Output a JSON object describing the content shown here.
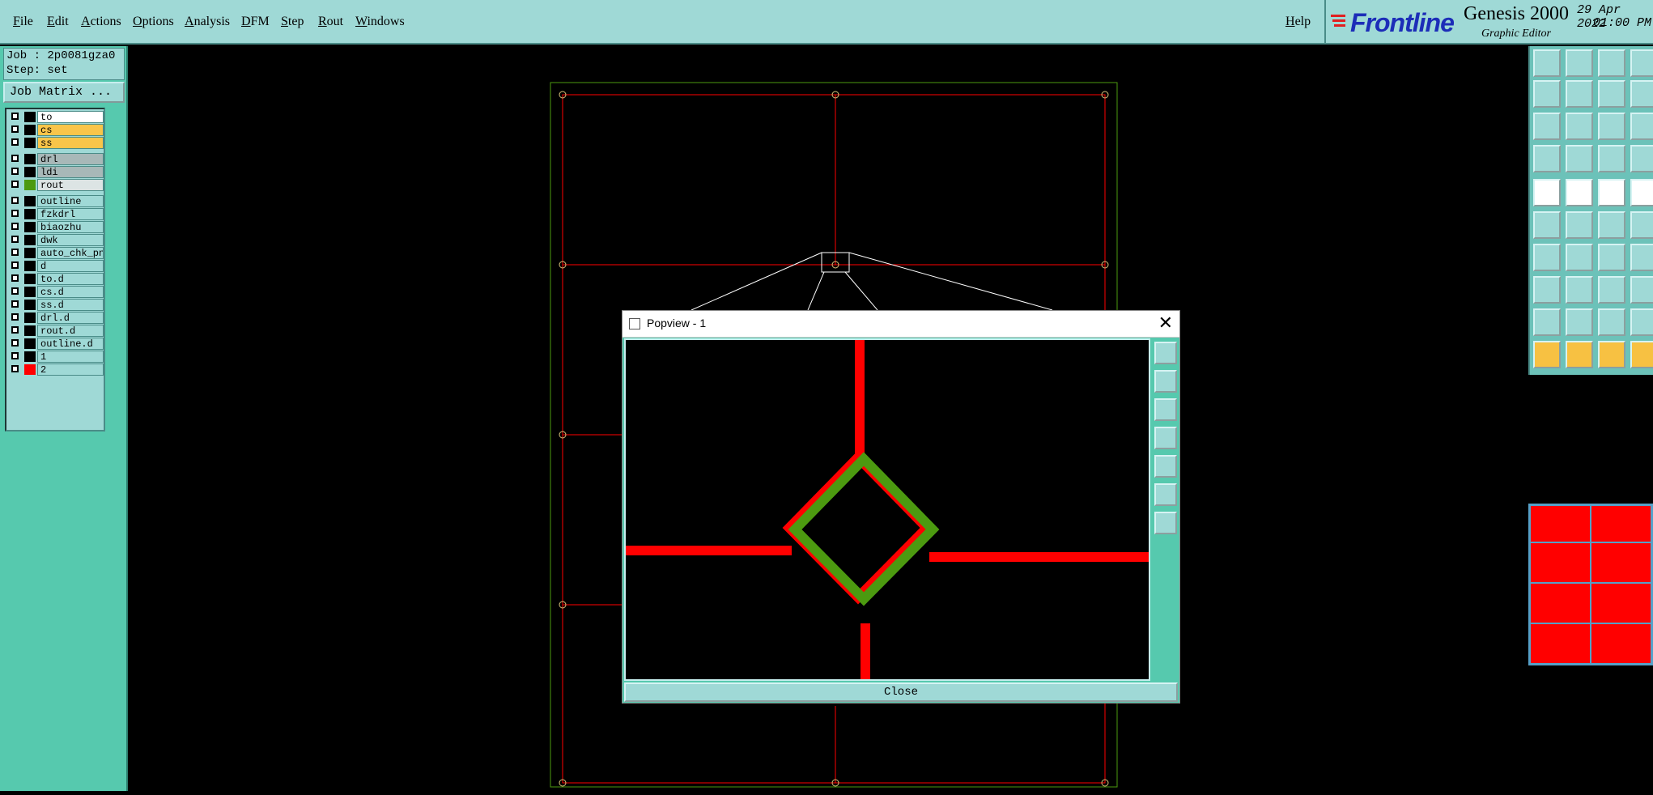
{
  "menubar": {
    "items": [
      "File",
      "Edit",
      "Actions",
      "Options",
      "Analysis",
      "DFM",
      "Step",
      "Rout",
      "Windows"
    ],
    "help": "Help"
  },
  "brand": {
    "logo": "Frontline",
    "title": "Genesis 2000",
    "subtitle": "Graphic Editor",
    "date": "29 Apr 2022",
    "time": "01:00 PM"
  },
  "job": {
    "job_label": "Job : 2p0081gza0",
    "step_label": "Step: set",
    "matrix_button": "Job Matrix ..."
  },
  "layers": [
    {
      "name": "to",
      "style": "active",
      "color": "#000000"
    },
    {
      "name": "cs",
      "style": "yellow",
      "color": "#000000"
    },
    {
      "name": "ss",
      "style": "yellow",
      "color": "#000000"
    },
    {
      "name": "drl",
      "style": "grey",
      "color": "#000000"
    },
    {
      "name": "ldi",
      "style": "grey",
      "color": "#000000"
    },
    {
      "name": "rout",
      "style": "light",
      "color": "#4c9a10"
    },
    {
      "name": "outline",
      "style": "",
      "color": "#000000"
    },
    {
      "name": "fzkdrl",
      "style": "",
      "color": "#000000"
    },
    {
      "name": "biaozhu",
      "style": "",
      "color": "#000000"
    },
    {
      "name": "dwk",
      "style": "",
      "color": "#000000"
    },
    {
      "name": "auto_chk_pn",
      "style": "",
      "color": "#000000"
    },
    {
      "name": "d",
      "style": "",
      "color": "#000000"
    },
    {
      "name": "to.d",
      "style": "",
      "color": "#000000"
    },
    {
      "name": "cs.d",
      "style": "",
      "color": "#000000"
    },
    {
      "name": "ss.d",
      "style": "",
      "color": "#000000"
    },
    {
      "name": "drl.d",
      "style": "",
      "color": "#000000"
    },
    {
      "name": "rout.d",
      "style": "",
      "color": "#000000"
    },
    {
      "name": "outline.d",
      "style": "",
      "color": "#000000"
    },
    {
      "name": "1",
      "style": "",
      "color": "#000000"
    },
    {
      "name": "2",
      "style": "",
      "color": "#ff0000"
    }
  ],
  "popview": {
    "title": "Popview - 1",
    "close_label": "Close",
    "close_x": "✕"
  },
  "colors": {
    "panel": "#9fd9d6",
    "trace": "#ff0000",
    "rout": "#4c9a10"
  }
}
